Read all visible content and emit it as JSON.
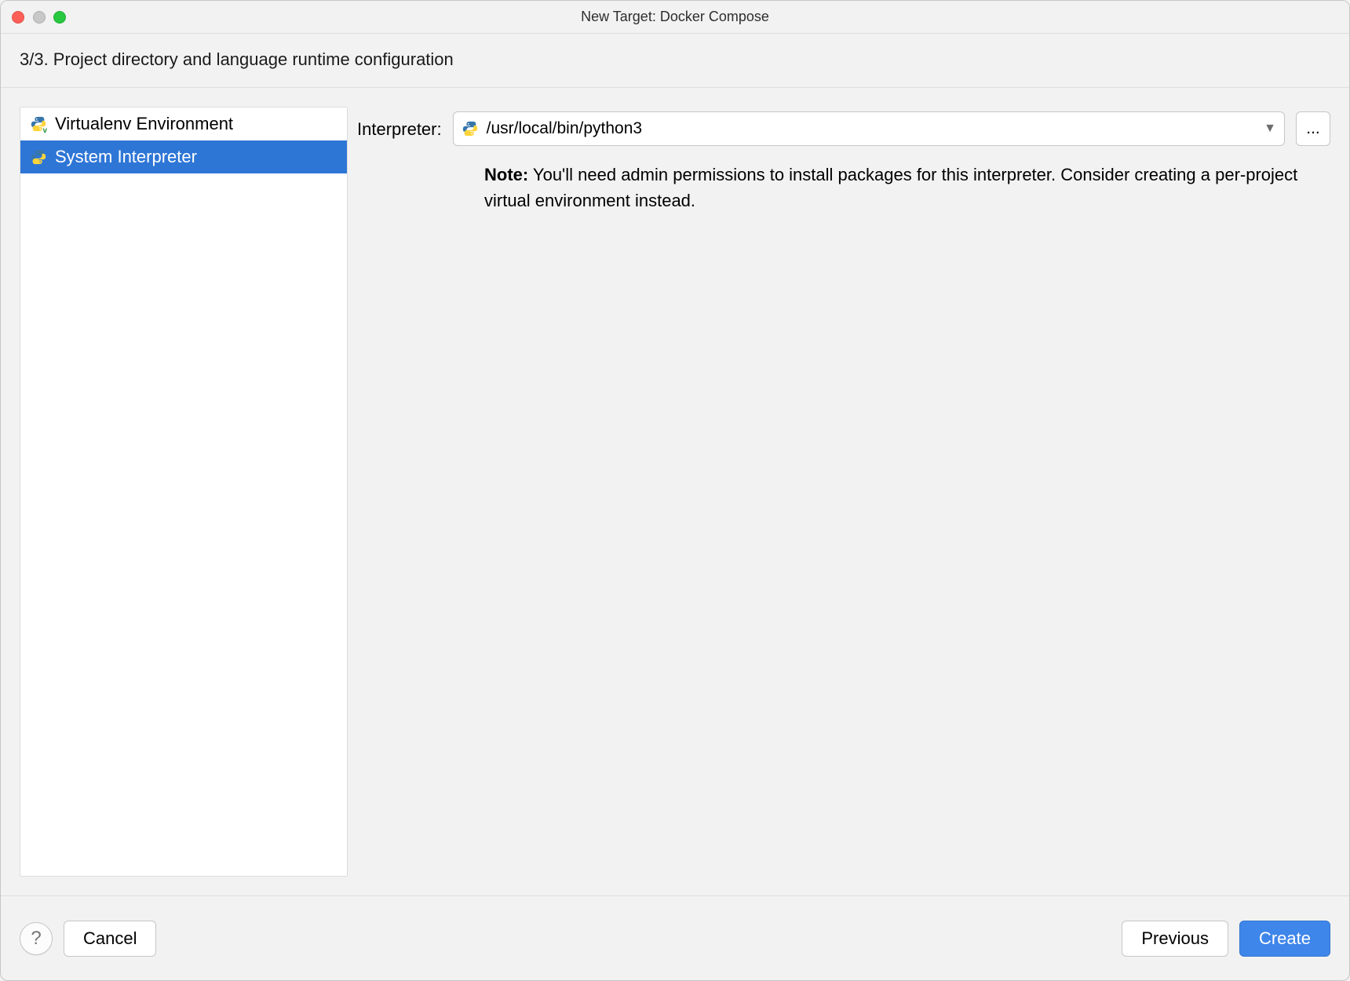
{
  "window": {
    "title": "New Target: Docker Compose"
  },
  "step": {
    "label": "3/3. Project directory and language runtime configuration"
  },
  "sidebar": {
    "items": [
      {
        "label": "Virtualenv Environment",
        "selected": false
      },
      {
        "label": "System Interpreter",
        "selected": true
      }
    ]
  },
  "main": {
    "interpreter_label": "Interpreter:",
    "interpreter_value": "/usr/local/bin/python3",
    "browse_label": "...",
    "note_bold": "Note:",
    "note_text": " You'll need admin permissions to install packages for this interpreter. Consider creating a per-project virtual environment instead."
  },
  "footer": {
    "help": "?",
    "cancel": "Cancel",
    "previous": "Previous",
    "create": "Create"
  }
}
